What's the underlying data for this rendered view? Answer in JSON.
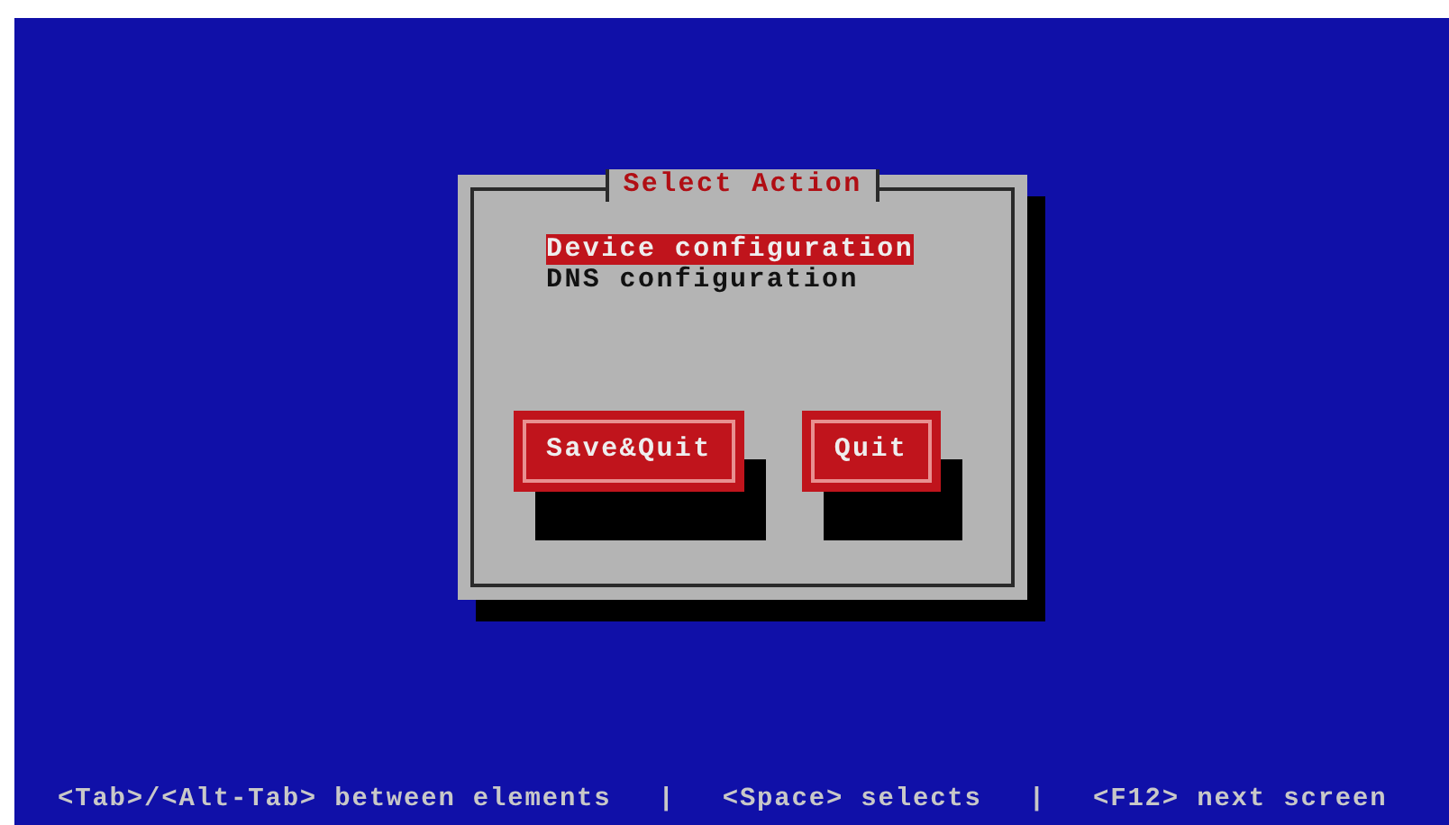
{
  "dialog": {
    "title": "Select Action",
    "items": [
      {
        "label": "Device configuration",
        "selected": true
      },
      {
        "label": "DNS configuration",
        "selected": false
      }
    ],
    "buttons": [
      {
        "label": "Save&Quit"
      },
      {
        "label": "Quit"
      }
    ]
  },
  "status_bar": [
    "<Tab>/<Alt-Tab> between elements",
    "|",
    "<Space> selects",
    "|",
    "<F12> next screen"
  ]
}
